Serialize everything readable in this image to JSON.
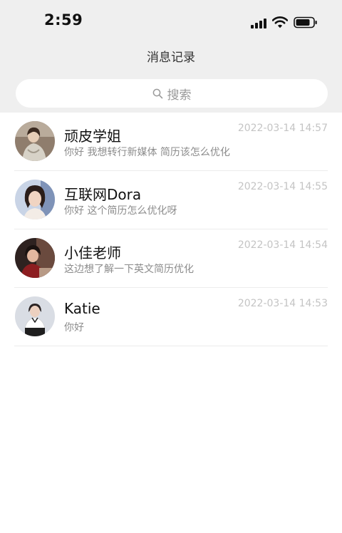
{
  "status_bar": {
    "time": "2:59",
    "icons": [
      "signal-icon",
      "wifi-icon",
      "battery-icon"
    ]
  },
  "nav": {
    "title": "消息记录"
  },
  "search": {
    "placeholder": "搜索",
    "icon": "search-icon"
  },
  "messages": [
    {
      "name": "顽皮学姐",
      "preview": "你好 我想转行新媒体 简历该怎么优化",
      "time": "2022-03-14 14:57"
    },
    {
      "name": "互联网Dora",
      "preview": "你好 这个简历怎么优化呀",
      "time": "2022-03-14 14:55"
    },
    {
      "name": "小佳老师",
      "preview": "这边想了解一下英文简历优化",
      "time": "2022-03-14 14:54"
    },
    {
      "name": "Katie",
      "preview": "你好",
      "time": "2022-03-14 14:53"
    }
  ],
  "colors": {
    "header_bg": "#efefef",
    "search_bg": "#ffffff",
    "title": "#333333",
    "name": "#111111",
    "preview": "#8c8c8c",
    "timestamp": "#c4c4c4",
    "divider": "#ececec"
  }
}
